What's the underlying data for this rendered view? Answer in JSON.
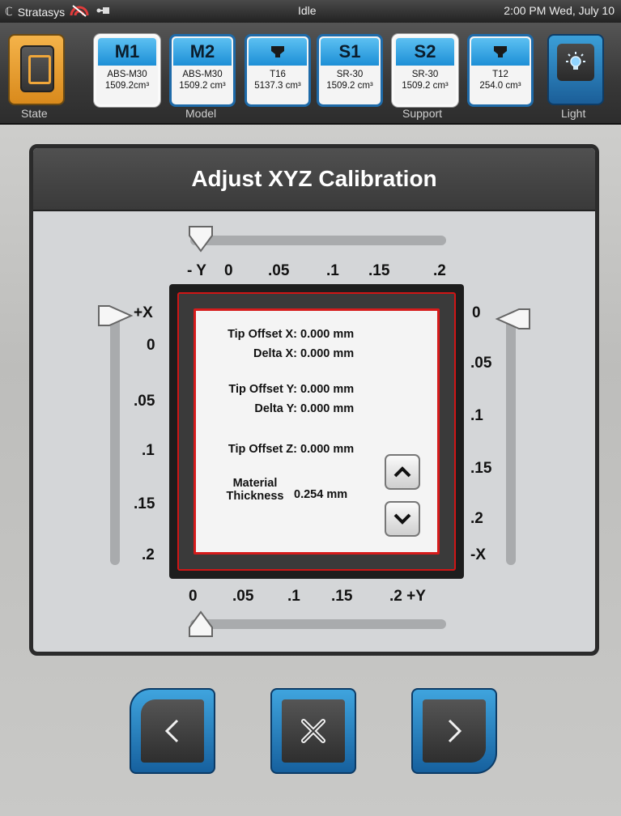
{
  "status_bar": {
    "brand": "Stratasys",
    "state": "Idle",
    "datetime": "2:00 PM Wed, July 10"
  },
  "header": {
    "state_label": "State",
    "model_label": "Model",
    "support_label": "Support",
    "light_label": "Light",
    "slots": [
      {
        "cap": "M1",
        "line1": "ABS-M30",
        "line2": "1509.2cm³"
      },
      {
        "cap": "M2",
        "line1": "ABS-M30",
        "line2": "1509.2 cm³"
      },
      {
        "cap": "",
        "icon": "tip-icon",
        "line1": "T16",
        "line2": "5137.3 cm³"
      },
      {
        "cap": "S1",
        "line1": "SR-30",
        "line2": "1509.2 cm³"
      },
      {
        "cap": "S2",
        "line1": "SR-30",
        "line2": "1509.2 cm³"
      },
      {
        "cap": "",
        "icon": "tip-icon",
        "line1": "T12",
        "line2": "254.0 cm³"
      }
    ]
  },
  "panel": {
    "title": "Adjust XYZ Calibration",
    "top_scale": [
      "- Y",
      "0",
      ".05",
      ".1",
      ".15",
      ".2"
    ],
    "bottom_scale": [
      "0",
      ".05",
      ".1",
      ".15",
      ".2 +Y"
    ],
    "left_scale": [
      "+X",
      "0",
      ".05",
      ".1",
      ".15",
      ".2"
    ],
    "right_scale": [
      "0",
      ".05",
      ".1",
      ".15",
      ".2",
      "-X"
    ],
    "info": {
      "tip_offset_x_label": "Tip Offset X:",
      "tip_offset_x_value": "0.000 mm",
      "delta_x_label": "Delta X:",
      "delta_x_value": "0.000 mm",
      "tip_offset_y_label": "Tip Offset Y:",
      "tip_offset_y_value": "0.000 mm",
      "delta_y_label": "Delta Y:",
      "delta_y_value": "0.000 mm",
      "tip_offset_z_label": "Tip Offset Z:",
      "tip_offset_z_value": "0.000 mm",
      "material_label_1": "Material",
      "material_label_2": "Thickness",
      "material_value": "0.254 mm"
    }
  },
  "colors": {
    "accent_blue": "#1d8fd6",
    "state_orange": "#f0a73a",
    "calib_red": "#d61b1b"
  }
}
